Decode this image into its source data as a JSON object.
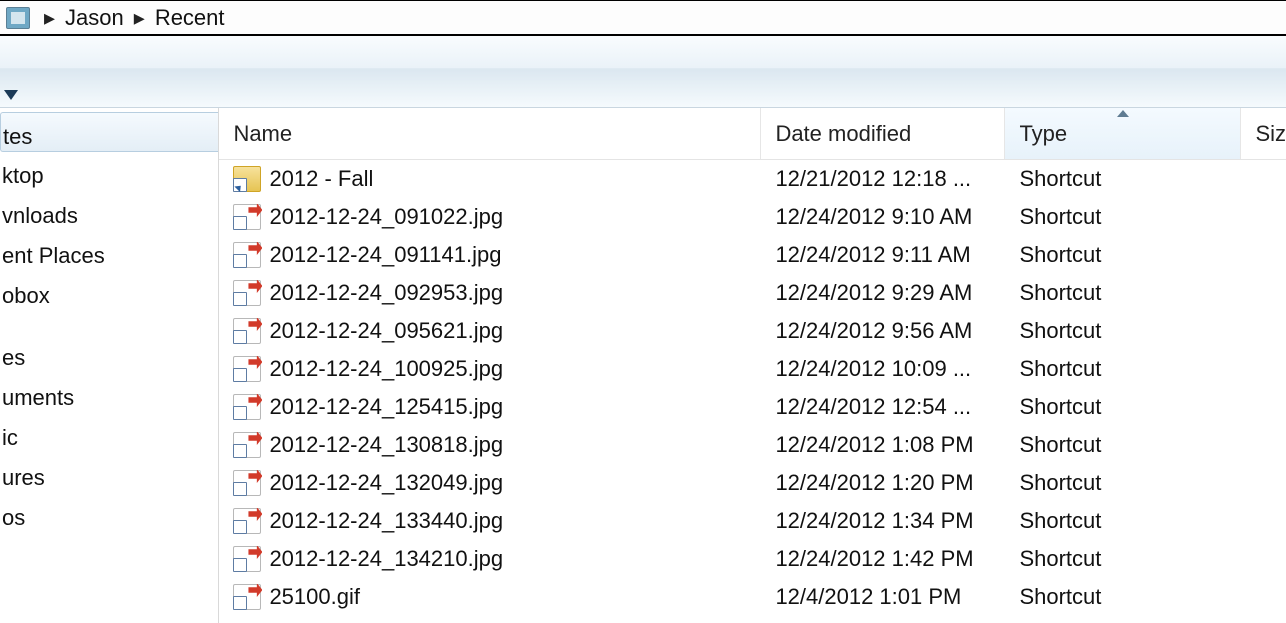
{
  "breadcrumb": {
    "parts": [
      "Jason",
      "Recent"
    ]
  },
  "sidebar": {
    "group1": [
      "tes",
      "ktop",
      "vnloads",
      "ent Places",
      "obox"
    ],
    "group2": [
      "es",
      "uments",
      "ic",
      "ures",
      "os"
    ],
    "selected_index": 0
  },
  "columns": {
    "name": "Name",
    "date": "Date modified",
    "type": "Type",
    "size": "Siz",
    "sorted": "type",
    "sort_dir": "asc"
  },
  "files": [
    {
      "icon": "folder",
      "name": "2012 - Fall",
      "date": "12/21/2012 12:18 ...",
      "type": "Shortcut"
    },
    {
      "icon": "img",
      "name": "2012-12-24_091022.jpg",
      "date": "12/24/2012 9:10 AM",
      "type": "Shortcut"
    },
    {
      "icon": "img",
      "name": "2012-12-24_091141.jpg",
      "date": "12/24/2012 9:11 AM",
      "type": "Shortcut"
    },
    {
      "icon": "img",
      "name": "2012-12-24_092953.jpg",
      "date": "12/24/2012 9:29 AM",
      "type": "Shortcut"
    },
    {
      "icon": "img",
      "name": "2012-12-24_095621.jpg",
      "date": "12/24/2012 9:56 AM",
      "type": "Shortcut"
    },
    {
      "icon": "img",
      "name": "2012-12-24_100925.jpg",
      "date": "12/24/2012 10:09 ...",
      "type": "Shortcut"
    },
    {
      "icon": "img",
      "name": "2012-12-24_125415.jpg",
      "date": "12/24/2012 12:54 ...",
      "type": "Shortcut"
    },
    {
      "icon": "img",
      "name": "2012-12-24_130818.jpg",
      "date": "12/24/2012 1:08 PM",
      "type": "Shortcut"
    },
    {
      "icon": "img",
      "name": "2012-12-24_132049.jpg",
      "date": "12/24/2012 1:20 PM",
      "type": "Shortcut"
    },
    {
      "icon": "img",
      "name": "2012-12-24_133440.jpg",
      "date": "12/24/2012 1:34 PM",
      "type": "Shortcut"
    },
    {
      "icon": "img",
      "name": "2012-12-24_134210.jpg",
      "date": "12/24/2012 1:42 PM",
      "type": "Shortcut"
    },
    {
      "icon": "img",
      "name": "25100.gif",
      "date": "12/4/2012 1:01 PM",
      "type": "Shortcut"
    }
  ]
}
